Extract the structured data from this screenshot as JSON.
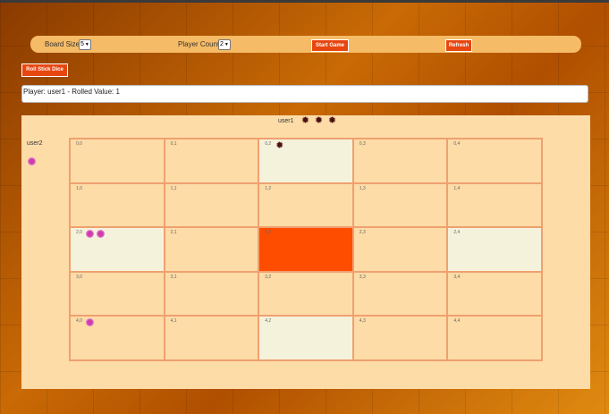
{
  "toolbar": {
    "board_size_label": "Board Size",
    "board_size_value": "5",
    "player_count_label": "Player Count",
    "player_count_value": "2",
    "start_game": "Start Game",
    "refresh": "Refresh"
  },
  "roll_button": "Roll Stick Dice",
  "status": "Player: user1 - Rolled Value: 1",
  "players": {
    "user1": {
      "name": "user1",
      "pieces_waiting": 3,
      "color": "#4a1010"
    },
    "user2": {
      "name": "user2",
      "pieces_waiting": 1,
      "color": "#d03bb0"
    }
  },
  "board": {
    "rows": [
      [
        {
          "label": "0,0",
          "type": "normal",
          "pieces": []
        },
        {
          "label": "0,1",
          "type": "normal",
          "pieces": []
        },
        {
          "label": "0,2",
          "type": "safe",
          "pieces": [
            "user1"
          ]
        },
        {
          "label": "0,3",
          "type": "normal",
          "pieces": []
        },
        {
          "label": "0,4",
          "type": "normal",
          "pieces": []
        }
      ],
      [
        {
          "label": "1,0",
          "type": "normal",
          "pieces": []
        },
        {
          "label": "1,1",
          "type": "normal",
          "pieces": []
        },
        {
          "label": "1,2",
          "type": "normal",
          "pieces": []
        },
        {
          "label": "1,3",
          "type": "normal",
          "pieces": []
        },
        {
          "label": "1,4",
          "type": "normal",
          "pieces": []
        }
      ],
      [
        {
          "label": "2,0",
          "type": "safe",
          "pieces": [
            "user2",
            "user2"
          ]
        },
        {
          "label": "2,1",
          "type": "normal",
          "pieces": []
        },
        {
          "label": "2,2",
          "type": "home",
          "pieces": []
        },
        {
          "label": "2,3",
          "type": "normal",
          "pieces": []
        },
        {
          "label": "2,4",
          "type": "safe",
          "pieces": []
        }
      ],
      [
        {
          "label": "3,0",
          "type": "normal",
          "pieces": []
        },
        {
          "label": "3,1",
          "type": "normal",
          "pieces": []
        },
        {
          "label": "3,2",
          "type": "normal",
          "pieces": []
        },
        {
          "label": "3,3",
          "type": "normal",
          "pieces": []
        },
        {
          "label": "3,4",
          "type": "normal",
          "pieces": []
        }
      ],
      [
        {
          "label": "4,0",
          "type": "normal",
          "pieces": [
            "user2"
          ]
        },
        {
          "label": "4,1",
          "type": "normal",
          "pieces": []
        },
        {
          "label": "4,2",
          "type": "safe",
          "pieces": []
        },
        {
          "label": "4,3",
          "type": "normal",
          "pieces": []
        },
        {
          "label": "4,4",
          "type": "normal",
          "pieces": []
        }
      ]
    ]
  }
}
